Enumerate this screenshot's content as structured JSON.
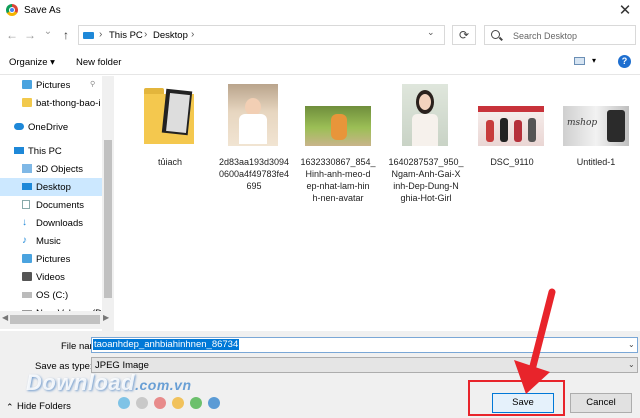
{
  "window": {
    "title": "Save As",
    "close_glyph": "✕"
  },
  "nav": {
    "back_glyph": "←",
    "forward_glyph": "→",
    "recent_glyph": "⌄",
    "up_glyph": "↑"
  },
  "address": {
    "crumbs": [
      "This PC",
      "Desktop"
    ],
    "sep_glyph": "›",
    "drop_glyph": "⌄",
    "refresh_glyph": "⟳"
  },
  "search": {
    "placeholder": "Search Desktop"
  },
  "toolbar": {
    "organize_label": "Organize ▾",
    "new_folder_label": "New folder",
    "view_drop_glyph": "▾",
    "help_label": "?"
  },
  "sidebar": {
    "items": [
      {
        "label": "Pictures",
        "icon": "pictures-icon",
        "pin": "📌"
      },
      {
        "label": "bat-thong-bao-i",
        "icon": "folder-icon"
      },
      {
        "label": "OneDrive",
        "icon": "cloud-icon"
      },
      {
        "label": "This PC",
        "icon": "pc-icon"
      },
      {
        "label": "3D Objects",
        "icon": "cube-icon"
      },
      {
        "label": "Desktop",
        "icon": "desktop-icon"
      },
      {
        "label": "Documents",
        "icon": "documents-icon"
      },
      {
        "label": "Downloads",
        "icon": "download-icon"
      },
      {
        "label": "Music",
        "icon": "music-icon"
      },
      {
        "label": "Pictures",
        "icon": "pictures-icon"
      },
      {
        "label": "Videos",
        "icon": "videos-icon"
      },
      {
        "label": "OS (C:)",
        "icon": "drive-icon"
      },
      {
        "label": "New Volume (D:",
        "icon": "drive-icon"
      }
    ],
    "selected": "Desktop"
  },
  "files": [
    {
      "name": [
        "tủiach"
      ],
      "kind": "folder"
    },
    {
      "name": [
        "2d83aa193d3094",
        "0600a4f49783fe4",
        "695"
      ],
      "kind": "image"
    },
    {
      "name": [
        "1632330867_854_",
        "Hinh-anh-meo-d",
        "ep-nhat-lam-hin",
        "h-nen-avatar"
      ],
      "kind": "image"
    },
    {
      "name": [
        "1640287537_950_",
        "Ngam-Anh-Gai-X",
        "inh-Dep-Dung-N",
        "ghia-Hot-Girl"
      ],
      "kind": "image"
    },
    {
      "name": [
        "DSC_9110"
      ],
      "kind": "image"
    },
    {
      "name": [
        "Untitled-1"
      ],
      "kind": "image"
    }
  ],
  "save": {
    "file_name_label": "File name:",
    "file_name_value": "taoanhdep_anhbiahinhnen_86734",
    "type_label": "Save as type:",
    "type_value": "JPEG Image",
    "hide_folders_label": "Hide Folders",
    "hide_glyph": "⌃",
    "save_label": "Save",
    "cancel_label": "Cancel"
  },
  "watermark": {
    "brand": "Download",
    "domain": ".com.vn"
  },
  "colors": {
    "accent": "#0078d7",
    "highlight": "#e8242b",
    "selected": "#cce8ff"
  },
  "dots": [
    "#7fc3e6",
    "#c9c9c9",
    "#e88b8b",
    "#f1c25c",
    "#6cc06c",
    "#5b9bd5",
    "#e76f4f"
  ]
}
